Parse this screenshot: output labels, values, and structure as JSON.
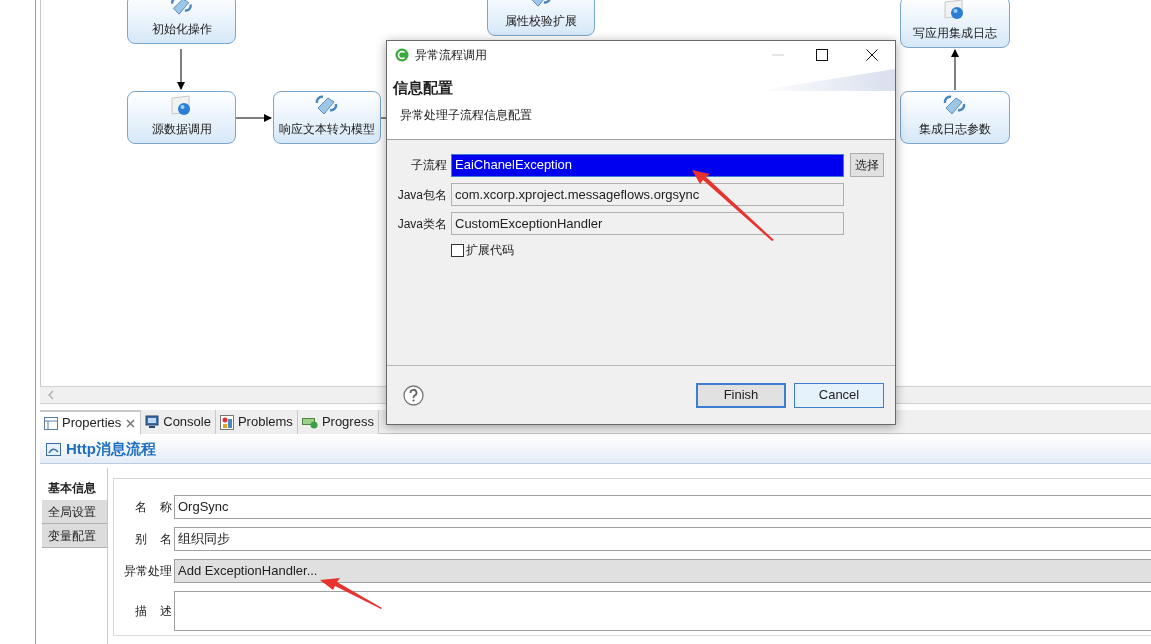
{
  "diagram": {
    "nodes": [
      {
        "label": "初始化操作",
        "kind": "plugin"
      },
      {
        "label": "源数据调用",
        "kind": "http"
      },
      {
        "label": "响应文本转为模型",
        "kind": "plugin"
      },
      {
        "label": "属性校验扩展",
        "kind": "plugin"
      },
      {
        "label": "写应用集成日志",
        "kind": "http"
      },
      {
        "label": "集成日志参数",
        "kind": "plugin"
      }
    ]
  },
  "dialog": {
    "title": "异常流程调用",
    "header": "信息配置",
    "description": "异常处理子流程信息配置",
    "fields": [
      {
        "label": "子流程",
        "value": "EaiChanelException",
        "selected": true
      },
      {
        "label": "Java包名",
        "value": "com.xcorp.xproject.messageflows.orgsync",
        "selected": false
      },
      {
        "label": "Java类名",
        "value": "CustomExceptionHandler",
        "selected": false
      }
    ],
    "select_button": "选择",
    "checkbox": {
      "label": "扩展代码",
      "checked": false
    },
    "buttons": [
      {
        "label": "Finish",
        "default": true
      },
      {
        "label": "Cancel",
        "default": false
      }
    ]
  },
  "views": {
    "tabs": [
      {
        "label": "Properties",
        "selected": true,
        "kind": "properties"
      },
      {
        "label": "Console",
        "selected": false,
        "kind": "console"
      },
      {
        "label": "Problems",
        "selected": false,
        "kind": "problems"
      },
      {
        "label": "Progress",
        "selected": false,
        "kind": "progress"
      }
    ]
  },
  "properties": {
    "title": "Http消息流程",
    "tabs": [
      {
        "label": "基本信息",
        "selected": true
      },
      {
        "label": "全局设置",
        "selected": false
      },
      {
        "label": "变量配置",
        "selected": false
      }
    ],
    "fields": [
      {
        "label": "名 称",
        "value": "OrgSync",
        "kind": "text"
      },
      {
        "label": "别 名",
        "value": "组织同步",
        "kind": "text"
      },
      {
        "label": "异常处理",
        "value": "Add ExceptionHandler...",
        "kind": "action"
      },
      {
        "label": "描 述",
        "kind": "textarea"
      }
    ]
  }
}
